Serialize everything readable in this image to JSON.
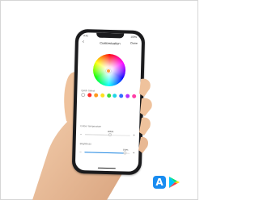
{
  "screen": {
    "status_time": "9:41",
    "status_battery": "100%",
    "back_glyph": "‹",
    "title": "Customization",
    "done_label": "Done",
    "wheel_selection_color": "#ff9e3d",
    "quick_select_label": "Quick Select",
    "quick_colors": [
      "#ffffff",
      "#ff2b2b",
      "#ff9a1f",
      "#ffe11f",
      "#3ddc3d",
      "#1fd6e6",
      "#2f6dff",
      "#b52fff",
      "#ff3ea5"
    ],
    "sliders": [
      {
        "label": "Colour temperature",
        "value_text": "3850K",
        "fraction": 0.55,
        "fill": "#d9d9d9",
        "minus": "–",
        "plus": "+"
      },
      {
        "label": "Brightness",
        "value_text": "100%",
        "fraction": 0.9,
        "fill": "#1e88e5",
        "minus": "–",
        "plus": "+"
      }
    ]
  },
  "badges": {
    "app_store_icon": "app-store-icon",
    "app_store_glyph": "A",
    "google_play_icon": "google-play-icon"
  },
  "colors": {
    "skin": "#f2c9a6",
    "phone_body": "#1b1b1d"
  }
}
